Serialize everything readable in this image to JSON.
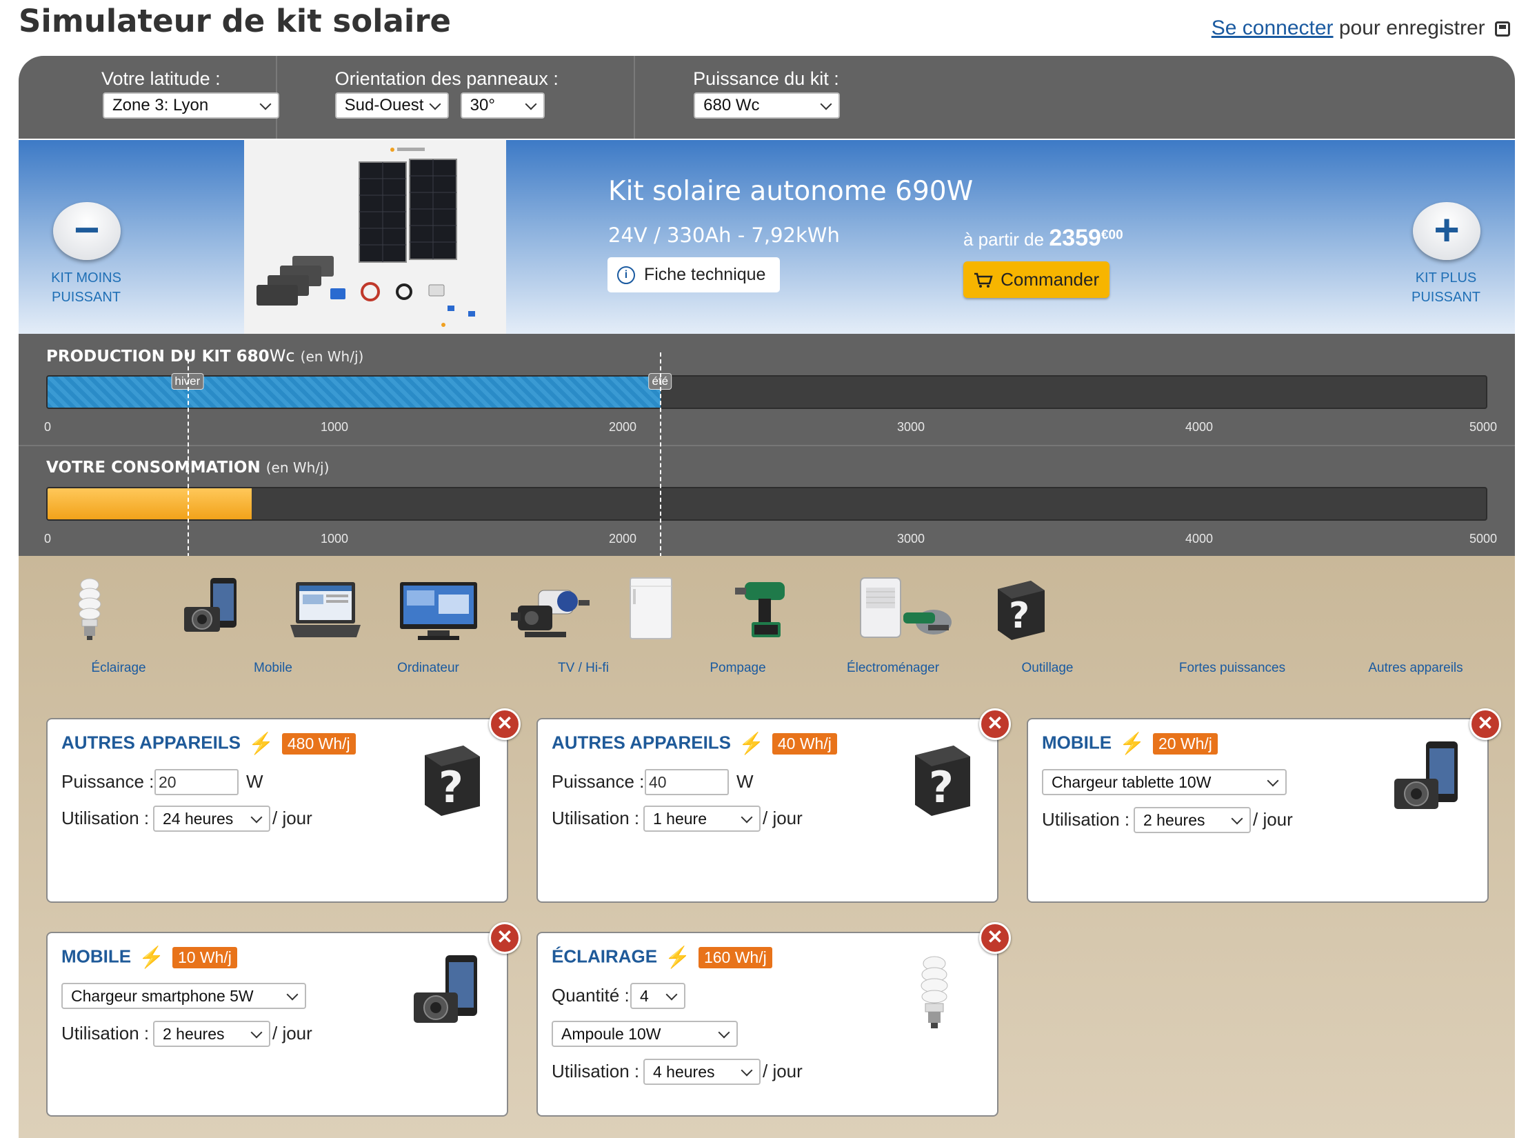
{
  "page": {
    "title": "Simulateur de kit solaire",
    "login_link": "Se connecter",
    "login_suffix": "pour enregistrer"
  },
  "controls": {
    "latitude_label": "Votre latitude :",
    "latitude_value": "Zone 3: Lyon",
    "orientation_label": "Orientation des panneaux :",
    "orientation_value": "Sud-Ouest",
    "tilt_value": "30°",
    "power_label": "Puissance du kit :",
    "power_value": "680 Wc"
  },
  "kit": {
    "prev_label_1": "KIT MOINS",
    "prev_label_2": "PUISSANT",
    "next_label_1": "KIT PLUS",
    "next_label_2": "PUISSANT",
    "name": "Kit solaire autonome 690W",
    "specs": "24V / 330Ah - 7,92kWh",
    "fiche_button": "Fiche technique",
    "price_prefix": "à partir de",
    "price_integer": "2359",
    "price_cents": "€00",
    "order_button": "Commander"
  },
  "production": {
    "title": "PRODUCTION DU KIT 680",
    "title_unit": "Wc",
    "unit_note": "(en Wh/j)",
    "winter_label": "hiver",
    "summer_label": "été",
    "winter_value": 490,
    "summer_value": 2130,
    "scale_max": 5000,
    "ticks": [
      "0",
      "1000",
      "2000",
      "3000",
      "4000",
      "5000"
    ]
  },
  "consumption": {
    "title": "VOTRE CONSOMMATION",
    "unit_note": "(en Wh/j)",
    "value": 710,
    "scale_max": 5000,
    "ticks": [
      "0",
      "1000",
      "2000",
      "3000",
      "4000",
      "5000"
    ]
  },
  "categories": [
    {
      "label": "Éclairage",
      "icon": "bulb-icon"
    },
    {
      "label": "Mobile",
      "icon": "phone-camera-icon"
    },
    {
      "label": "Ordinateur",
      "icon": "laptop-icon"
    },
    {
      "label": "TV / Hi-fi",
      "icon": "tv-icon"
    },
    {
      "label": "Pompage",
      "icon": "pump-icon"
    },
    {
      "label": "Électroménager",
      "icon": "fridge-icon"
    },
    {
      "label": "Outillage",
      "icon": "drill-icon"
    },
    {
      "label": "Fortes puissances",
      "icon": "heavy-appliance-icon"
    },
    {
      "label": "Autres appareils",
      "icon": "question-box-icon"
    }
  ],
  "cards": [
    {
      "title": "AUTRES APPAREILS",
      "badge": "480 Wh/j",
      "power_label": "Puissance :",
      "power_value": "20",
      "power_unit": "W",
      "usage_label": "Utilisation :",
      "usage_value": "24 heures",
      "usage_suffix": "/ jour"
    },
    {
      "title": "AUTRES APPAREILS",
      "badge": "40 Wh/j",
      "power_label": "Puissance :",
      "power_value": "40",
      "power_unit": "W",
      "usage_label": "Utilisation :",
      "usage_value": "1 heure",
      "usage_suffix": "/ jour"
    },
    {
      "title": "MOBILE",
      "badge": "20 Wh/j",
      "device_value": "Chargeur tablette 10W",
      "usage_label": "Utilisation :",
      "usage_value": "2 heures",
      "usage_suffix": "/ jour"
    },
    {
      "title": "MOBILE",
      "badge": "10 Wh/j",
      "device_value": "Chargeur smartphone 5W",
      "usage_label": "Utilisation :",
      "usage_value": "2 heures",
      "usage_suffix": "/ jour"
    },
    {
      "title": "ÉCLAIRAGE",
      "badge": "160 Wh/j",
      "qty_label": "Quantité :",
      "qty_value": "4",
      "device_value": "Ampoule 10W",
      "usage_label": "Utilisation :",
      "usage_value": "4 heures",
      "usage_suffix": "/ jour"
    }
  ],
  "colors": {
    "accent_blue": "#1f5a99",
    "badge_orange": "#e8731a",
    "order_yellow": "#f7b500",
    "production_blue": "#2a8bc7",
    "consumption_orange": "#f1a21a"
  }
}
